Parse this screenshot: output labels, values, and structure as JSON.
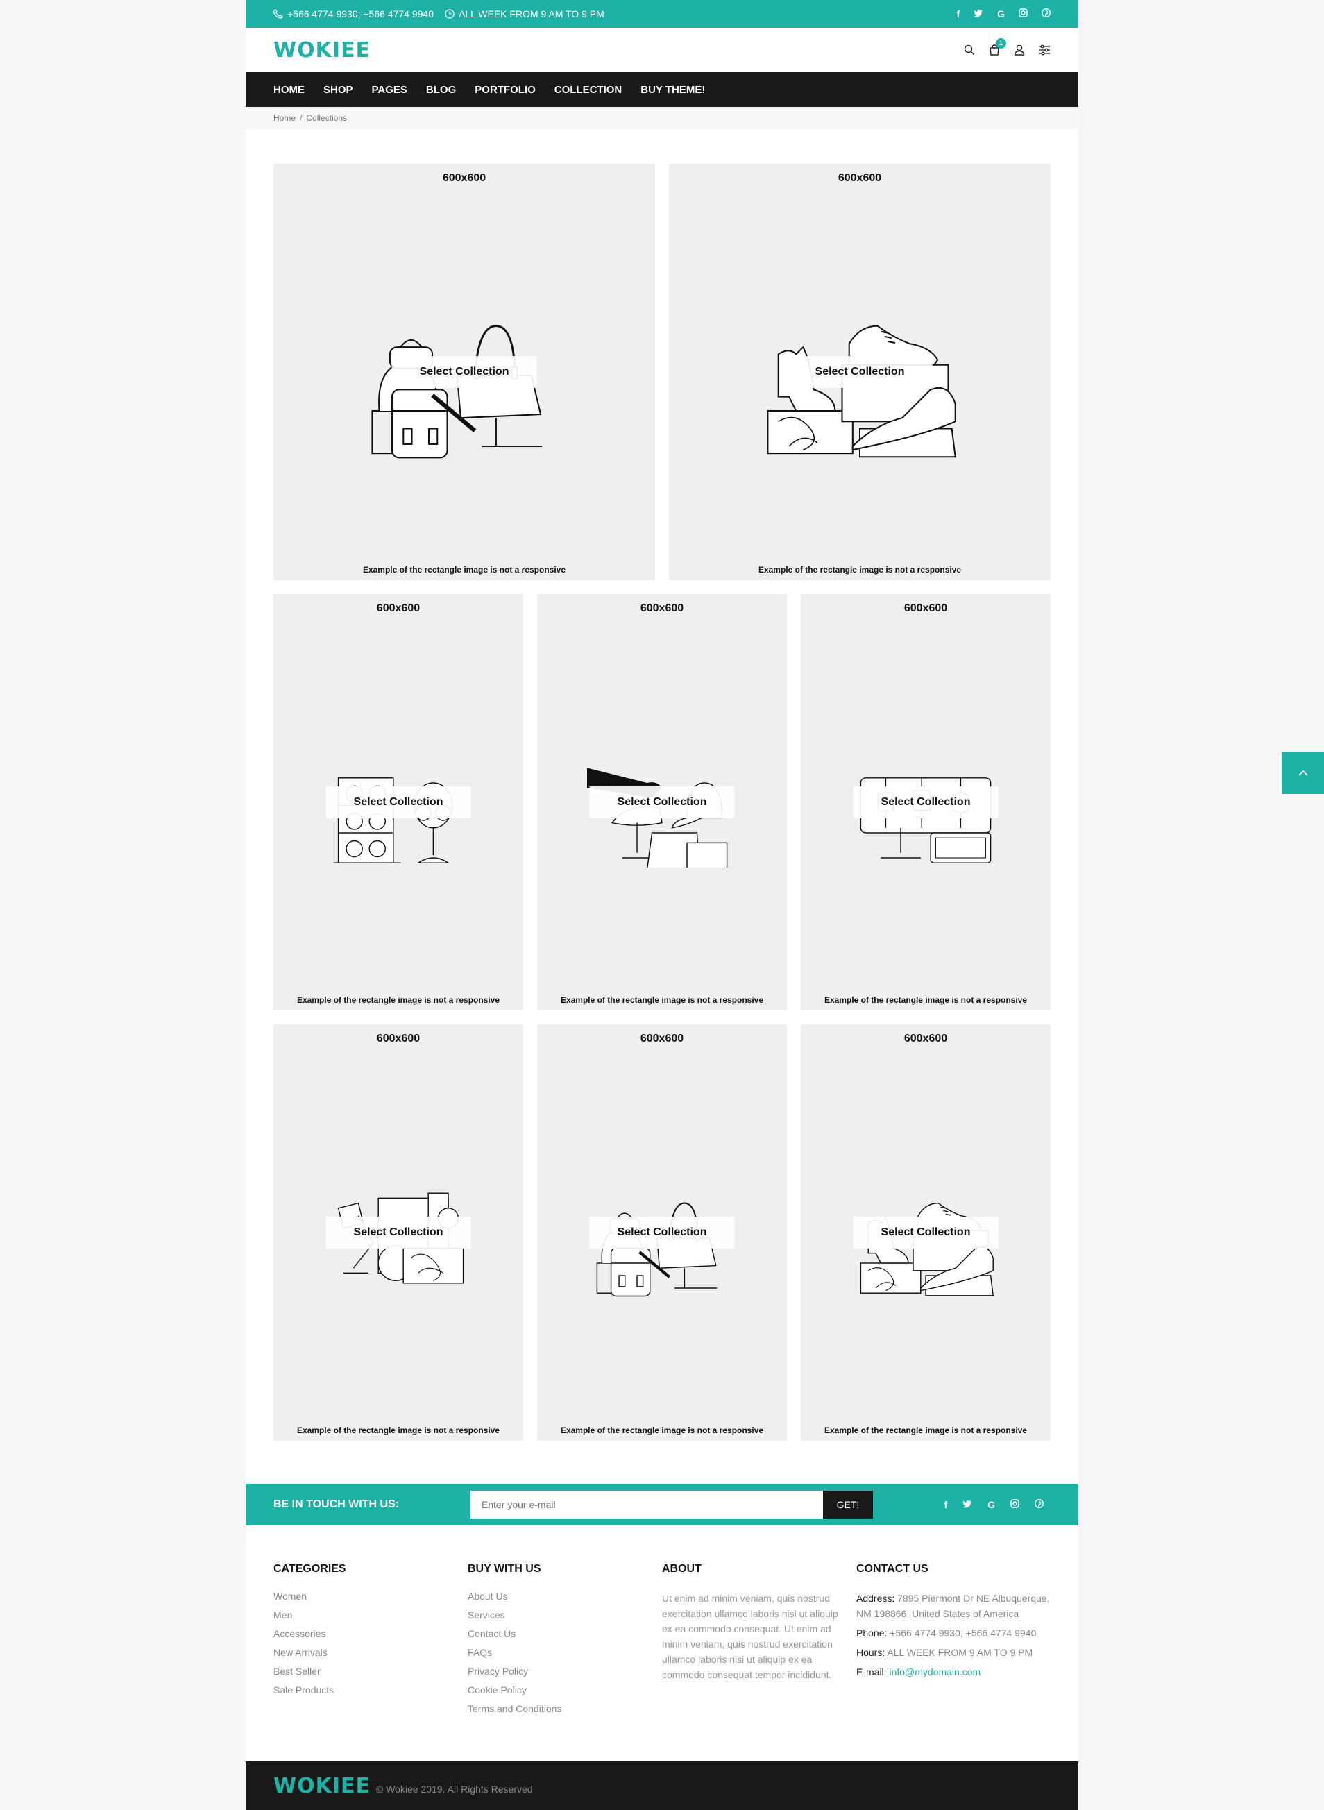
{
  "topbar": {
    "phone": "+566 4774 9930; +566 4774 9940",
    "hours": "ALL WEEK FROM 9 AM TO 9 PM",
    "social": [
      "f",
      "t",
      "G",
      "ig",
      "p"
    ]
  },
  "header": {
    "logo": "WOKIEE",
    "cart_count": "1"
  },
  "nav": [
    "HOME",
    "SHOP",
    "PAGES",
    "BLOG",
    "PORTFOLIO",
    "COLLECTION",
    "BUY THEME!"
  ],
  "breadcrumb": {
    "home": "Home",
    "sep": "/",
    "current": "Collections"
  },
  "collections": [
    {
      "size": "600x600",
      "button": "Select Collection",
      "caption": "Example of the rectangle image is not a responsive",
      "illustration": "bags"
    },
    {
      "size": "600x600",
      "button": "Select Collection",
      "caption": "Example of the rectangle image is not a responsive",
      "illustration": "shoes"
    },
    {
      "size": "600x600",
      "button": "Select Collection",
      "caption": "Example of the rectangle image is not a responsive",
      "illustration": "glasses"
    },
    {
      "size": "600x600",
      "button": "Select Collection",
      "caption": "Example of the rectangle image is not a responsive",
      "illustration": "hats"
    },
    {
      "size": "600x600",
      "button": "Select Collection",
      "caption": "Example of the rectangle image is not a responsive",
      "illustration": "watches"
    },
    {
      "size": "600x600",
      "button": "Select Collection",
      "caption": "Example of the rectangle image is not a responsive",
      "illustration": "home-decor"
    },
    {
      "size": "600x600",
      "button": "Select Collection",
      "caption": "Example of the rectangle image is not a responsive",
      "illustration": "bags"
    },
    {
      "size": "600x600",
      "button": "Select Collection",
      "caption": "Example of the rectangle image is not a responsive",
      "illustration": "shoes"
    }
  ],
  "newsletter": {
    "label": "BE IN TOUCH WITH US:",
    "placeholder": "Enter your e-mail",
    "button": "GET!"
  },
  "footer": {
    "categories": {
      "title": "CATEGORIES",
      "links": [
        "Women",
        "Men",
        "Accessories",
        "New Arrivals",
        "Best Seller",
        "Sale Products"
      ]
    },
    "buy": {
      "title": "BUY WITH US",
      "links": [
        "About Us",
        "Services",
        "Contact Us",
        "FAQs",
        "Privacy Policy",
        "Cookie Policy",
        "Terms and Conditions"
      ]
    },
    "about": {
      "title": "ABOUT",
      "text": "Ut enim ad minim veniam, quis nostrud exercitation ullamco laboris nisi ut aliquip ex ea commodo consequat. Ut enim ad minim veniam, quis nostrud exercitation ullamco laboris nisi ut aliquip ex ea commodo consequat tempor incididunt."
    },
    "contact": {
      "title": "CONTACT US",
      "address_label": "Address:",
      "address": "7895 Piermont Dr NE Albuquerque, NM 198866, United States of America",
      "phone_label": "Phone:",
      "phone": "+566 4774 9930; +566 4774 9940",
      "hours_label": "Hours:",
      "hours": "ALL WEEK FROM 9 AM TO 9 PM",
      "email_label": "E-mail:",
      "email": "info@mydomain.com"
    }
  },
  "bottom": {
    "logo": "WOKIEE",
    "copyright": "© Wokiee 2019. All Rights Reserved"
  },
  "colors": {
    "accent": "#1eb2a6",
    "dark": "#191919",
    "card": "#efefef"
  }
}
